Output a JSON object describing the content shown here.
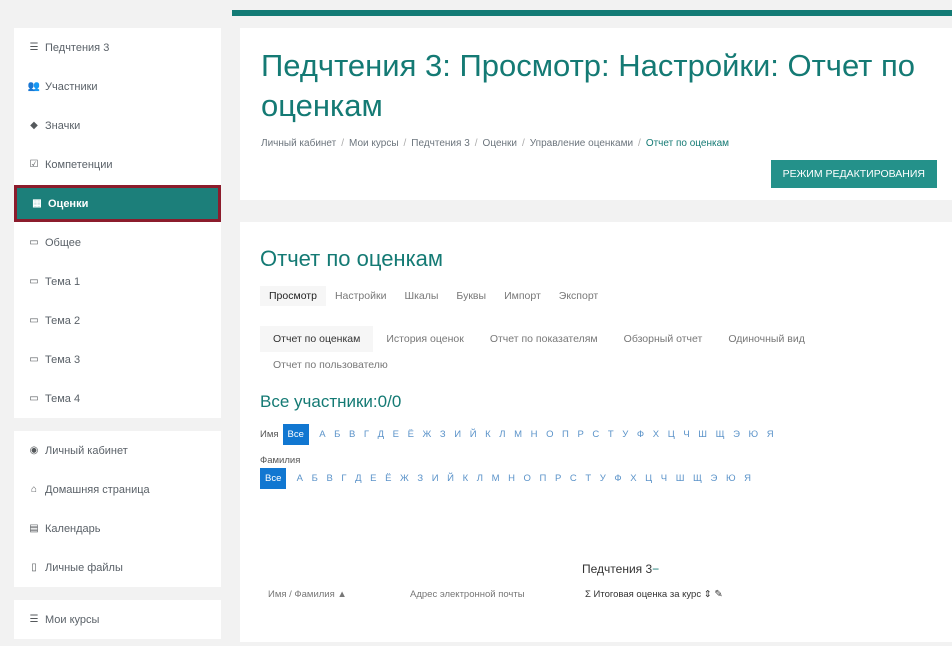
{
  "sidebar": {
    "group1": [
      {
        "icon": "list-icon",
        "glyph": "☰",
        "label": "Педчтения 3"
      },
      {
        "icon": "users-icon",
        "glyph": "👥",
        "label": "Участники"
      },
      {
        "icon": "badge-icon",
        "glyph": "◆",
        "label": "Значки"
      },
      {
        "icon": "check-icon",
        "glyph": "☑",
        "label": "Компетенции"
      },
      {
        "icon": "grades-table-icon",
        "glyph": "▦",
        "label": "Оценки"
      },
      {
        "icon": "folder-icon",
        "glyph": "▭",
        "label": "Общее"
      },
      {
        "icon": "folder-icon",
        "glyph": "▭",
        "label": "Тема 1"
      },
      {
        "icon": "folder-icon",
        "glyph": "▭",
        "label": "Тема 2"
      },
      {
        "icon": "folder-icon",
        "glyph": "▭",
        "label": "Тема 3"
      },
      {
        "icon": "folder-icon",
        "glyph": "▭",
        "label": "Тема 4"
      }
    ],
    "group2": [
      {
        "icon": "dashboard-icon",
        "glyph": "◉",
        "label": "Личный кабинет"
      },
      {
        "icon": "home-icon",
        "glyph": "⌂",
        "label": "Домашняя страница"
      },
      {
        "icon": "calendar-icon",
        "glyph": "▤",
        "label": "Календарь"
      },
      {
        "icon": "file-icon",
        "glyph": "▯",
        "label": "Личные файлы"
      }
    ],
    "group3": [
      {
        "icon": "list-icon",
        "glyph": "☰",
        "label": "Мои курсы"
      }
    ]
  },
  "header": {
    "title": "Педчтения 3: Просмотр: Настройки: Отчет по оценкам",
    "breadcrumb": [
      "Личный кабинет",
      "Мои курсы",
      "Педчтения 3",
      "Оценки",
      "Управление оценками",
      "Отчет по оценкам"
    ],
    "edit_button": "РЕЖИМ РЕДАКТИРОВАНИЯ"
  },
  "report": {
    "title": "Отчет по оценкам",
    "tabs_primary": [
      "Просмотр",
      "Настройки",
      "Шкалы",
      "Буквы",
      "Импорт",
      "Экспорт"
    ],
    "tabs_secondary": [
      "Отчет по оценкам",
      "История оценок",
      "Отчет по показателям",
      "Обзорный отчет",
      "Одиночный вид",
      "Отчет по пользователю"
    ],
    "participants": "Все участники:0/0",
    "first_name_label": "Имя",
    "last_name_label": "Фамилия",
    "all_label": "Все",
    "letters": [
      "А",
      "Б",
      "В",
      "Г",
      "Д",
      "Е",
      "Ё",
      "Ж",
      "З",
      "И",
      "Й",
      "К",
      "Л",
      "М",
      "Н",
      "О",
      "П",
      "Р",
      "С",
      "Т",
      "У",
      "Ф",
      "Х",
      "Ц",
      "Ч",
      "Ш",
      "Щ",
      "Э",
      "Ю",
      "Я"
    ],
    "course_name": "Педчтения 3",
    "col_name": "Имя / Фамилия",
    "col_email": "Адрес электронной почты",
    "col_total": "Итоговая оценка за курс"
  },
  "colors": {
    "accent": "#147a74",
    "active_item": "#1c7f7a",
    "highlight_border": "#8c1c2c",
    "letter_active": "#1177d1"
  }
}
